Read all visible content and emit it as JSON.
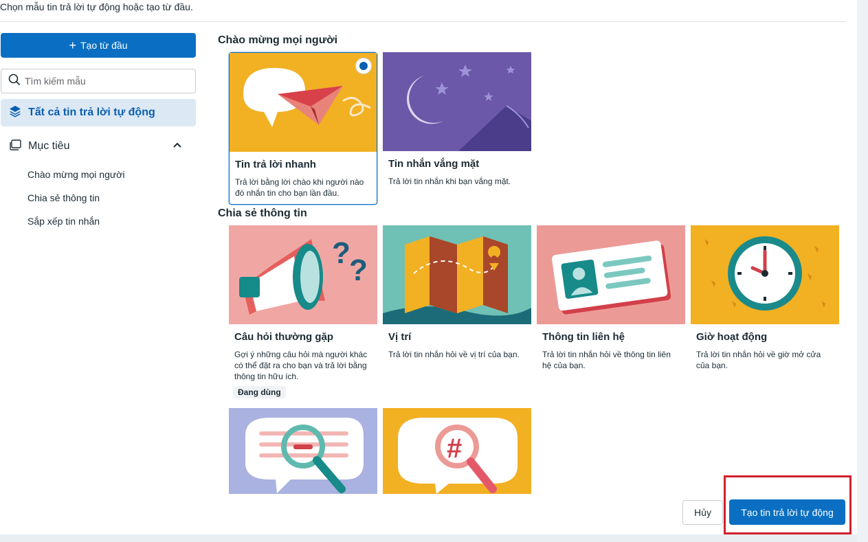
{
  "header": {
    "intro": "Chọn mẫu tin trả lời tự động hoặc tạo từ đầu."
  },
  "sidebar": {
    "create_label": "Tạo từ đầu",
    "search_placeholder": "Tìm kiếm mẫu",
    "all_label": "Tất cả tin trả lời tự động",
    "goal_label": "Mục tiêu",
    "sub_items": [
      "Chào mừng mọi người",
      "Chia sẻ thông tin",
      "Sắp xếp tin nhắn"
    ]
  },
  "sections": [
    {
      "title": "Chào mừng mọi người",
      "cards": [
        {
          "title": "Tin trả lời nhanh",
          "desc": "Trả lời bằng lời chào khi người nào đó nhắn tin cho bạn lần đầu.",
          "selected": true
        },
        {
          "title": "Tin nhắn vắng mặt",
          "desc": "Trả lời tin nhắn khi bạn vắng mặt."
        }
      ]
    },
    {
      "title": "Chia sẻ thông tin",
      "cards": [
        {
          "title": "Câu hỏi thường gặp",
          "desc": "Gợi ý những câu hỏi mà người khác có thể đặt ra cho bạn và trả lời bằng thông tin hữu ích.",
          "badge": "Đang dùng"
        },
        {
          "title": "Vị trí",
          "desc": "Trả lời tin nhắn hỏi về vị trí của bạn."
        },
        {
          "title": "Thông tin liên hệ",
          "desc": "Trả lời tin nhắn hỏi về thông tin liên hệ của bạn."
        },
        {
          "title": "Giờ hoạt động",
          "desc": "Trả lời tin nhắn hỏi về giờ mở cửa của bạn."
        }
      ]
    }
  ],
  "footer": {
    "cancel_label": "Hủy",
    "submit_label": "Tạo tin trả lời tự động"
  },
  "colors": {
    "primary": "#0a6fc2",
    "highlight": "#d21f2b"
  }
}
